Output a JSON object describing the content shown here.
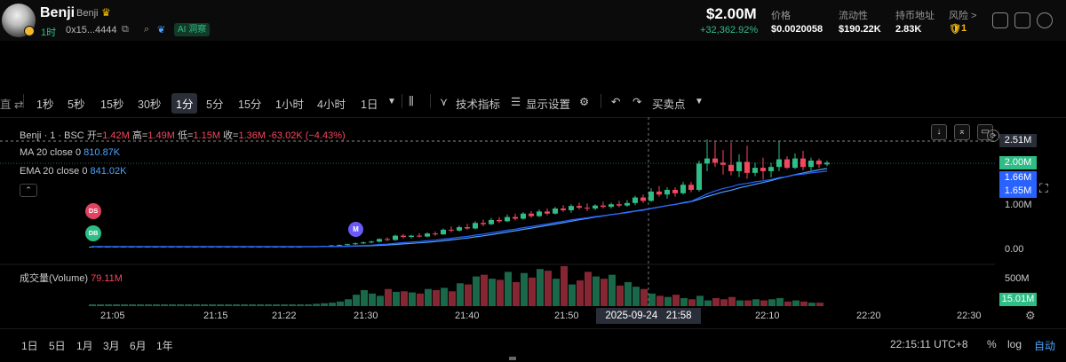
{
  "header": {
    "token_name": "Benji",
    "token_sub": "Benji",
    "age": "1时",
    "address": "0x15...4444",
    "ai_badge": "AI 洞察",
    "price": "$2.00M",
    "price_change": "+32,362.92%",
    "stats": [
      {
        "label": "价格",
        "value": "$0.0020058"
      },
      {
        "label": "流动性",
        "value": "$190.22K"
      },
      {
        "label": "持币地址",
        "value": "2.83K"
      }
    ],
    "risk_label": "风险 >",
    "risk_value": "1"
  },
  "toolbar": {
    "left_cut": "直 ⇄",
    "timeframes": [
      "1秒",
      "5秒",
      "15秒",
      "30秒",
      "1分",
      "5分",
      "15分",
      "1小时",
      "4小时",
      "1日"
    ],
    "active_timeframe": "1分",
    "indicators": "技术指标",
    "display_settings": "显示设置",
    "buy_sell": "买卖点"
  },
  "legend": {
    "symbol": "Benji · 1 · BSC",
    "open_label": "开=",
    "open": "1.42M",
    "high_label": "高=",
    "high": "1.49M",
    "low_label": "低=",
    "low": "1.15M",
    "close_label": "收=",
    "close": "1.36M",
    "change": "-63.02K (−4.43%)",
    "ma_label": "MA 20 close 0",
    "ma_value": "810.87K",
    "ema_label": "EMA 20 close 0",
    "ema_value": "841.02K",
    "volume_label": "成交量(Volume)",
    "volume_value": "79.11M"
  },
  "markers": {
    "ds": "DS",
    "db": "DB",
    "m": "M"
  },
  "price_axis": {
    "labels": [
      "2.51M",
      "1.00M",
      "0.00"
    ],
    "tags": [
      {
        "text": "2.51M",
        "color": "#2a2e39"
      },
      {
        "text": "2.00M",
        "color": "#2ebd85"
      },
      {
        "text": "1.66M",
        "color": "#2962ff"
      },
      {
        "text": "1.65M",
        "color": "#2962ff"
      }
    ],
    "volume_max": "500M",
    "volume_tag": "15.01M"
  },
  "time_axis": {
    "labels": [
      "21:05",
      "21:15",
      "21:22",
      "21:30",
      "21:40",
      "21:50",
      "22:10",
      "22:20",
      "22:30"
    ],
    "crosshair": "2025-09-24   21:58"
  },
  "bottom": {
    "ranges": [
      "1日",
      "5日",
      "1月",
      "3月",
      "6月",
      "1年"
    ],
    "clock": "22:15:11 UTC+8",
    "pct": "%",
    "log": "log",
    "auto": "自动"
  },
  "colors": {
    "up": "#2ebd85",
    "down": "#f6465d",
    "ma": "#4aa3ff",
    "ema": "#2962ff"
  },
  "chart_data": {
    "type": "candlestick",
    "y_axis_labels": [
      "2.51M",
      "1.00M",
      "0.00"
    ],
    "candles": [
      {
        "o": 0.02,
        "h": 0.03,
        "l": 0.01,
        "c": 0.02
      },
      {
        "o": 0.02,
        "h": 0.03,
        "l": 0.01,
        "c": 0.02
      },
      {
        "o": 0.02,
        "h": 0.03,
        "l": 0.01,
        "c": 0.02
      },
      {
        "o": 0.02,
        "h": 0.03,
        "l": 0.01,
        "c": 0.02
      },
      {
        "o": 0.02,
        "h": 0.03,
        "l": 0.01,
        "c": 0.02
      },
      {
        "o": 0.02,
        "h": 0.03,
        "l": 0.01,
        "c": 0.02
      },
      {
        "o": 0.02,
        "h": 0.03,
        "l": 0.01,
        "c": 0.02
      },
      {
        "o": 0.02,
        "h": 0.03,
        "l": 0.01,
        "c": 0.02
      },
      {
        "o": 0.02,
        "h": 0.03,
        "l": 0.01,
        "c": 0.02
      },
      {
        "o": 0.02,
        "h": 0.03,
        "l": 0.01,
        "c": 0.02
      },
      {
        "o": 0.02,
        "h": 0.03,
        "l": 0.01,
        "c": 0.02
      },
      {
        "o": 0.02,
        "h": 0.03,
        "l": 0.01,
        "c": 0.02
      },
      {
        "o": 0.02,
        "h": 0.03,
        "l": 0.01,
        "c": 0.02
      },
      {
        "o": 0.02,
        "h": 0.03,
        "l": 0.01,
        "c": 0.02
      },
      {
        "o": 0.02,
        "h": 0.03,
        "l": 0.01,
        "c": 0.02
      },
      {
        "o": 0.02,
        "h": 0.03,
        "l": 0.01,
        "c": 0.02
      },
      {
        "o": 0.02,
        "h": 0.03,
        "l": 0.01,
        "c": 0.02
      },
      {
        "o": 0.02,
        "h": 0.03,
        "l": 0.01,
        "c": 0.02
      },
      {
        "o": 0.02,
        "h": 0.03,
        "l": 0.01,
        "c": 0.02
      },
      {
        "o": 0.02,
        "h": 0.03,
        "l": 0.01,
        "c": 0.02
      },
      {
        "o": 0.02,
        "h": 0.03,
        "l": 0.01,
        "c": 0.02
      },
      {
        "o": 0.02,
        "h": 0.03,
        "l": 0.01,
        "c": 0.02
      },
      {
        "o": 0.02,
        "h": 0.03,
        "l": 0.01,
        "c": 0.02
      },
      {
        "o": 0.02,
        "h": 0.03,
        "l": 0.01,
        "c": 0.02
      },
      {
        "o": 0.02,
        "h": 0.03,
        "l": 0.01,
        "c": 0.02
      },
      {
        "o": 0.02,
        "h": 0.03,
        "l": 0.01,
        "c": 0.02
      },
      {
        "o": 0.02,
        "h": 0.03,
        "l": 0.01,
        "c": 0.02
      },
      {
        "o": 0.02,
        "h": 0.03,
        "l": 0.01,
        "c": 0.03
      },
      {
        "o": 0.03,
        "h": 0.04,
        "l": 0.02,
        "c": 0.03
      },
      {
        "o": 0.03,
        "h": 0.04,
        "l": 0.02,
        "c": 0.04
      },
      {
        "o": 0.04,
        "h": 0.06,
        "l": 0.03,
        "c": 0.05
      },
      {
        "o": 0.05,
        "h": 0.07,
        "l": 0.04,
        "c": 0.06
      },
      {
        "o": 0.06,
        "h": 0.09,
        "l": 0.05,
        "c": 0.08
      },
      {
        "o": 0.08,
        "h": 0.12,
        "l": 0.06,
        "c": 0.1
      },
      {
        "o": 0.1,
        "h": 0.14,
        "l": 0.08,
        "c": 0.12
      },
      {
        "o": 0.12,
        "h": 0.16,
        "l": 0.1,
        "c": 0.14
      },
      {
        "o": 0.14,
        "h": 0.22,
        "l": 0.12,
        "c": 0.2
      },
      {
        "o": 0.2,
        "h": 0.24,
        "l": 0.15,
        "c": 0.18
      },
      {
        "o": 0.18,
        "h": 0.3,
        "l": 0.16,
        "c": 0.28
      },
      {
        "o": 0.28,
        "h": 0.32,
        "l": 0.22,
        "c": 0.25
      },
      {
        "o": 0.25,
        "h": 0.3,
        "l": 0.22,
        "c": 0.28
      },
      {
        "o": 0.28,
        "h": 0.34,
        "l": 0.24,
        "c": 0.26
      },
      {
        "o": 0.26,
        "h": 0.36,
        "l": 0.24,
        "c": 0.33
      },
      {
        "o": 0.33,
        "h": 0.38,
        "l": 0.28,
        "c": 0.31
      },
      {
        "o": 0.31,
        "h": 0.45,
        "l": 0.3,
        "c": 0.42
      },
      {
        "o": 0.42,
        "h": 0.5,
        "l": 0.36,
        "c": 0.4
      },
      {
        "o": 0.4,
        "h": 0.52,
        "l": 0.38,
        "c": 0.48
      },
      {
        "o": 0.48,
        "h": 0.56,
        "l": 0.42,
        "c": 0.45
      },
      {
        "o": 0.45,
        "h": 0.62,
        "l": 0.43,
        "c": 0.58
      },
      {
        "o": 0.58,
        "h": 0.66,
        "l": 0.5,
        "c": 0.55
      },
      {
        "o": 0.55,
        "h": 0.7,
        "l": 0.53,
        "c": 0.65
      },
      {
        "o": 0.65,
        "h": 0.72,
        "l": 0.58,
        "c": 0.62
      },
      {
        "o": 0.62,
        "h": 0.78,
        "l": 0.6,
        "c": 0.72
      },
      {
        "o": 0.72,
        "h": 0.8,
        "l": 0.64,
        "c": 0.68
      },
      {
        "o": 0.68,
        "h": 0.84,
        "l": 0.66,
        "c": 0.8
      },
      {
        "o": 0.8,
        "h": 0.86,
        "l": 0.7,
        "c": 0.74
      },
      {
        "o": 0.74,
        "h": 0.9,
        "l": 0.72,
        "c": 0.85
      },
      {
        "o": 0.85,
        "h": 0.92,
        "l": 0.76,
        "c": 0.8
      },
      {
        "o": 0.8,
        "h": 0.96,
        "l": 0.78,
        "c": 0.92
      },
      {
        "o": 0.92,
        "h": 1.0,
        "l": 0.84,
        "c": 0.88
      },
      {
        "o": 0.88,
        "h": 1.02,
        "l": 0.82,
        "c": 0.98
      },
      {
        "o": 0.98,
        "h": 1.06,
        "l": 0.9,
        "c": 0.94
      },
      {
        "o": 0.94,
        "h": 1.04,
        "l": 0.86,
        "c": 0.92
      },
      {
        "o": 0.92,
        "h": 1.02,
        "l": 0.88,
        "c": 0.99
      },
      {
        "o": 0.99,
        "h": 1.08,
        "l": 0.92,
        "c": 0.96
      },
      {
        "o": 0.96,
        "h": 1.06,
        "l": 0.92,
        "c": 1.02
      },
      {
        "o": 1.02,
        "h": 1.1,
        "l": 0.95,
        "c": 0.99
      },
      {
        "o": 0.99,
        "h": 1.12,
        "l": 0.96,
        "c": 1.05
      },
      {
        "o": 1.05,
        "h": 1.22,
        "l": 1.0,
        "c": 1.18
      },
      {
        "o": 1.18,
        "h": 1.25,
        "l": 1.05,
        "c": 1.1
      },
      {
        "o": 1.1,
        "h": 1.4,
        "l": 1.08,
        "c": 1.32
      },
      {
        "o": 1.32,
        "h": 1.45,
        "l": 1.2,
        "c": 1.25
      },
      {
        "o": 1.25,
        "h": 1.42,
        "l": 1.15,
        "c": 1.36
      },
      {
        "o": 1.36,
        "h": 1.42,
        "l": 1.2,
        "c": 1.28
      },
      {
        "o": 1.28,
        "h": 1.55,
        "l": 1.25,
        "c": 1.48
      },
      {
        "o": 1.48,
        "h": 1.55,
        "l": 1.3,
        "c": 1.36
      },
      {
        "o": 1.36,
        "h": 2.05,
        "l": 1.32,
        "c": 1.98
      },
      {
        "o": 1.98,
        "h": 2.55,
        "l": 1.8,
        "c": 2.1
      },
      {
        "o": 2.1,
        "h": 2.5,
        "l": 1.9,
        "c": 2.0
      },
      {
        "o": 2.0,
        "h": 2.3,
        "l": 1.72,
        "c": 1.95
      },
      {
        "o": 1.95,
        "h": 2.48,
        "l": 1.7,
        "c": 1.8
      },
      {
        "o": 1.8,
        "h": 2.2,
        "l": 1.66,
        "c": 2.02
      },
      {
        "o": 2.02,
        "h": 2.4,
        "l": 1.62,
        "c": 1.76
      },
      {
        "o": 1.76,
        "h": 2.0,
        "l": 1.68,
        "c": 1.88
      },
      {
        "o": 1.88,
        "h": 2.12,
        "l": 1.6,
        "c": 1.8
      },
      {
        "o": 1.8,
        "h": 2.0,
        "l": 1.65,
        "c": 1.9
      },
      {
        "o": 1.9,
        "h": 2.5,
        "l": 1.8,
        "c": 2.08
      },
      {
        "o": 2.08,
        "h": 2.15,
        "l": 1.85,
        "c": 1.88
      },
      {
        "o": 1.88,
        "h": 2.22,
        "l": 1.85,
        "c": 2.1
      },
      {
        "o": 2.1,
        "h": 2.28,
        "l": 1.82,
        "c": 1.9
      },
      {
        "o": 1.9,
        "h": 2.12,
        "l": 1.82,
        "c": 2.05
      },
      {
        "o": 2.05,
        "h": 2.1,
        "l": 1.88,
        "c": 1.96
      },
      {
        "o": 1.96,
        "h": 2.05,
        "l": 1.92,
        "c": 2.0
      }
    ],
    "volume": [
      3,
      3,
      3,
      3,
      3,
      3,
      3,
      3,
      3,
      3,
      3,
      3,
      3,
      3,
      3,
      3,
      3,
      3,
      3,
      3,
      3,
      3,
      3,
      3,
      3,
      3,
      3,
      3,
      4,
      5,
      6,
      8,
      12,
      20,
      28,
      22,
      18,
      30,
      25,
      26,
      24,
      22,
      30,
      28,
      32,
      26,
      40,
      38,
      52,
      55,
      48,
      46,
      60,
      42,
      58,
      50,
      65,
      62,
      48,
      70,
      38,
      45,
      60,
      52,
      48,
      55,
      36,
      42,
      34,
      30,
      22,
      18,
      16,
      20,
      14,
      12,
      18,
      10,
      14,
      12,
      16,
      10,
      10,
      12,
      10,
      12,
      14,
      8,
      10,
      8,
      6,
      6
    ]
  }
}
